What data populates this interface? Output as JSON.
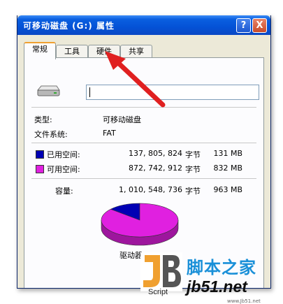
{
  "window": {
    "title": "可移动磁盘 (G:) 属性",
    "help_label": "?",
    "close_label": "X"
  },
  "tabs": [
    {
      "label": "常规",
      "active": true
    },
    {
      "label": "工具",
      "active": false
    },
    {
      "label": "硬件",
      "active": false
    },
    {
      "label": "共享",
      "active": false
    }
  ],
  "general": {
    "type_label": "类型:",
    "type_value": "可移动磁盘",
    "fs_label": "文件系统:",
    "fs_value": "FAT",
    "used": {
      "label": "已用空间:",
      "bytes": "137, 805, 824",
      "unit": "字节",
      "size": "131 MB",
      "color": "#0000b4"
    },
    "free": {
      "label": "可用空间:",
      "bytes": "872, 742, 912",
      "unit": "字节",
      "size": "832 MB",
      "color": "#e020e0"
    },
    "capacity": {
      "label": "容量:",
      "bytes": "1, 010, 548, 736",
      "unit": "字节",
      "size": "963 MB"
    },
    "drive_label": "驱动器 G"
  },
  "chart_data": {
    "type": "pie",
    "slices": [
      {
        "name": "已用空间",
        "value": 137805824,
        "color": "#0000b4"
      },
      {
        "name": "可用空间",
        "value": 872742912,
        "color": "#e020e0"
      }
    ]
  },
  "annotation_color": "#e02020",
  "watermark": {
    "logo_text": "JB",
    "script_label": "Script",
    "cn_text": "脚本之家",
    "en_text": "jb51.net",
    "small_text": "www.Jb51.net"
  }
}
